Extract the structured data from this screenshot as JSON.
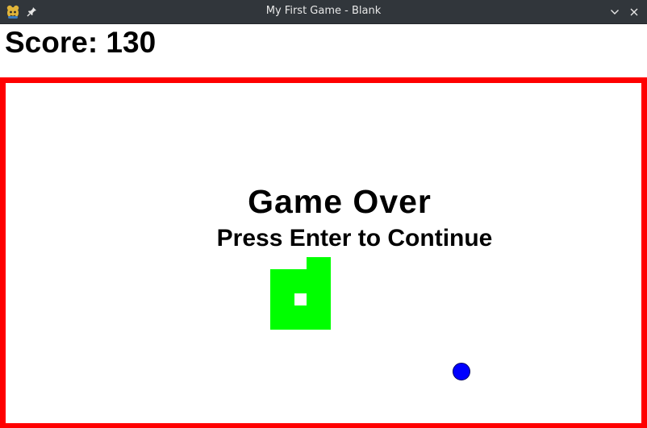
{
  "window": {
    "title": "My First Game - Blank",
    "app_icon": "python-snake-icon",
    "pin_icon": "pin-icon",
    "minimize_icon": "chevron-down-icon",
    "close_icon": "close-icon",
    "titlebar_color": "#31363b"
  },
  "hud": {
    "score_text": "Score: 130"
  },
  "game": {
    "game_over_text": "Game Over",
    "continue_text": "Press Enter to Continue",
    "border_color": "#ff0000",
    "snake_color": "#00ff00",
    "ball_color": "#0000ff"
  }
}
